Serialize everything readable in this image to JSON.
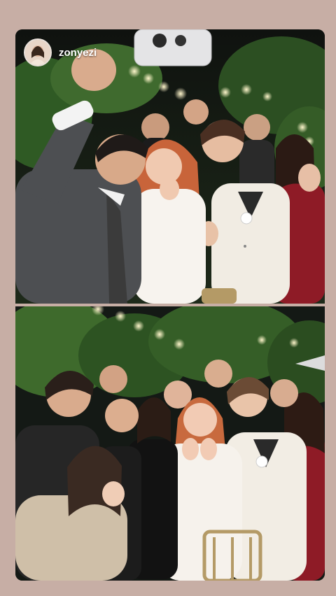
{
  "story": {
    "username": "zonyezi"
  },
  "icons": {
    "avatar": "profile-avatar"
  },
  "colors": {
    "frame": "#c7aea5",
    "night_background": "#1b1f1a",
    "foliage": "#3f6a2e",
    "lights": "#fff3c4"
  }
}
